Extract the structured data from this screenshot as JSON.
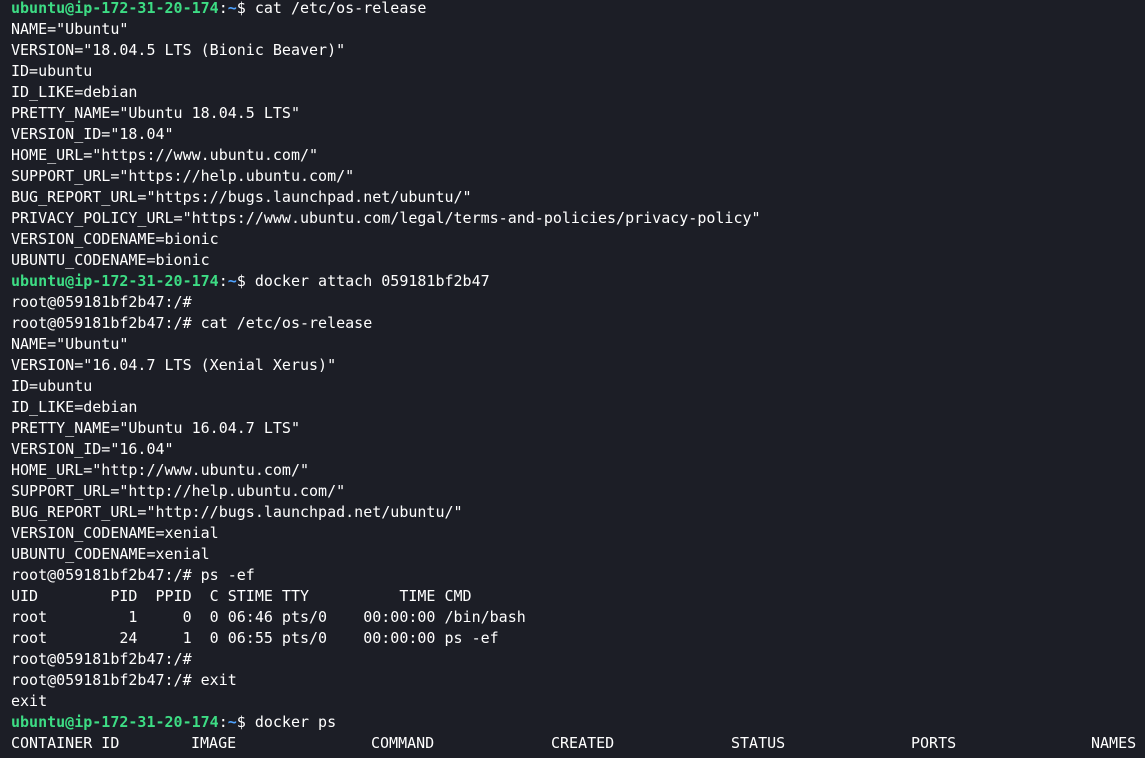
{
  "terminal": {
    "prompt_user_host": "ubuntu@ip-172-31-20-174",
    "prompt_cwd": "~",
    "prompt_symbol": "$",
    "lines": [
      {
        "type": "prompt",
        "command": "cat /etc/os-release"
      },
      {
        "type": "output",
        "text": "NAME=\"Ubuntu\""
      },
      {
        "type": "output",
        "text": "VERSION=\"18.04.5 LTS (Bionic Beaver)\""
      },
      {
        "type": "output",
        "text": "ID=ubuntu"
      },
      {
        "type": "output",
        "text": "ID_LIKE=debian"
      },
      {
        "type": "output",
        "text": "PRETTY_NAME=\"Ubuntu 18.04.5 LTS\""
      },
      {
        "type": "output",
        "text": "VERSION_ID=\"18.04\""
      },
      {
        "type": "output",
        "text": "HOME_URL=\"https://www.ubuntu.com/\""
      },
      {
        "type": "output",
        "text": "SUPPORT_URL=\"https://help.ubuntu.com/\""
      },
      {
        "type": "output",
        "text": "BUG_REPORT_URL=\"https://bugs.launchpad.net/ubuntu/\""
      },
      {
        "type": "output",
        "text": "PRIVACY_POLICY_URL=\"https://www.ubuntu.com/legal/terms-and-policies/privacy-policy\""
      },
      {
        "type": "output",
        "text": "VERSION_CODENAME=bionic"
      },
      {
        "type": "output",
        "text": "UBUNTU_CODENAME=bionic"
      },
      {
        "type": "prompt",
        "command": "docker attach 059181bf2b47"
      },
      {
        "type": "output",
        "text": "root@059181bf2b47:/#"
      },
      {
        "type": "output",
        "text": "root@059181bf2b47:/# cat /etc/os-release"
      },
      {
        "type": "output",
        "text": "NAME=\"Ubuntu\""
      },
      {
        "type": "output",
        "text": "VERSION=\"16.04.7 LTS (Xenial Xerus)\""
      },
      {
        "type": "output",
        "text": "ID=ubuntu"
      },
      {
        "type": "output",
        "text": "ID_LIKE=debian"
      },
      {
        "type": "output",
        "text": "PRETTY_NAME=\"Ubuntu 16.04.7 LTS\""
      },
      {
        "type": "output",
        "text": "VERSION_ID=\"16.04\""
      },
      {
        "type": "output",
        "text": "HOME_URL=\"http://www.ubuntu.com/\""
      },
      {
        "type": "output",
        "text": "SUPPORT_URL=\"http://help.ubuntu.com/\""
      },
      {
        "type": "output",
        "text": "BUG_REPORT_URL=\"http://bugs.launchpad.net/ubuntu/\""
      },
      {
        "type": "output",
        "text": "VERSION_CODENAME=xenial"
      },
      {
        "type": "output",
        "text": "UBUNTU_CODENAME=xenial"
      },
      {
        "type": "output",
        "text": "root@059181bf2b47:/# ps -ef"
      },
      {
        "type": "output",
        "text": "UID        PID  PPID  C STIME TTY          TIME CMD"
      },
      {
        "type": "output",
        "text": "root         1     0  0 06:46 pts/0    00:00:00 /bin/bash"
      },
      {
        "type": "output",
        "text": "root        24     1  0 06:55 pts/0    00:00:00 ps -ef"
      },
      {
        "type": "output",
        "text": "root@059181bf2b47:/#"
      },
      {
        "type": "output",
        "text": "root@059181bf2b47:/# exit"
      },
      {
        "type": "output",
        "text": "exit"
      },
      {
        "type": "prompt",
        "command": "docker ps"
      },
      {
        "type": "header",
        "columns": [
          "CONTAINER ID",
          "IMAGE",
          "COMMAND",
          "CREATED",
          "STATUS",
          "PORTS",
          "NAMES"
        ]
      }
    ]
  },
  "colors": {
    "background": "#1c1e26",
    "prompt_user_host": "#3ddc84",
    "prompt_cwd": "#4fa3ff",
    "text": "#ffffff"
  }
}
